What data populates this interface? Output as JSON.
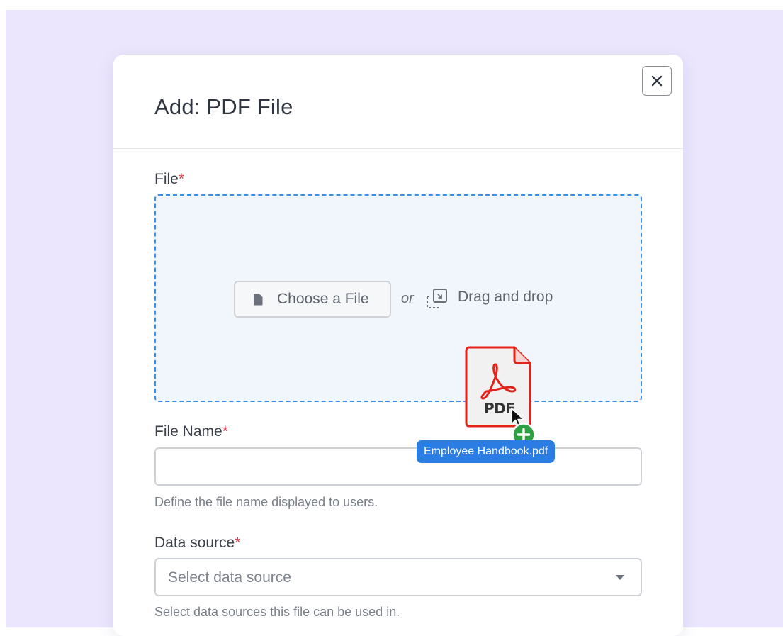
{
  "dialog": {
    "title": "Add: PDF File",
    "close_label": "close"
  },
  "file_field": {
    "label": "File",
    "required_mark": "*",
    "choose_button_label": "Choose a File",
    "or_text": "or",
    "drag_drop_text": "Drag and drop"
  },
  "file_name_field": {
    "label": "File Name",
    "required_mark": "*",
    "value": "",
    "help_text": "Define the file name displayed to users."
  },
  "data_source_field": {
    "label": "Data source",
    "required_mark": "*",
    "placeholder": "Select data source",
    "help_text": "Select data sources this file can be used in."
  },
  "drag_overlay": {
    "file_icon_text": "PDF",
    "file_name": "Employee Handbook.pdf",
    "badge_icon": "plus-icon"
  },
  "colors": {
    "backdrop": "#ebe6fd",
    "required": "#d93a4a",
    "dropzone_border": "#3b8fe0",
    "dropzone_fill": "#f1f6fd",
    "drag_chip": "#2b7de3",
    "pdf_red": "#e2231a",
    "badge_green": "#2ea043"
  }
}
